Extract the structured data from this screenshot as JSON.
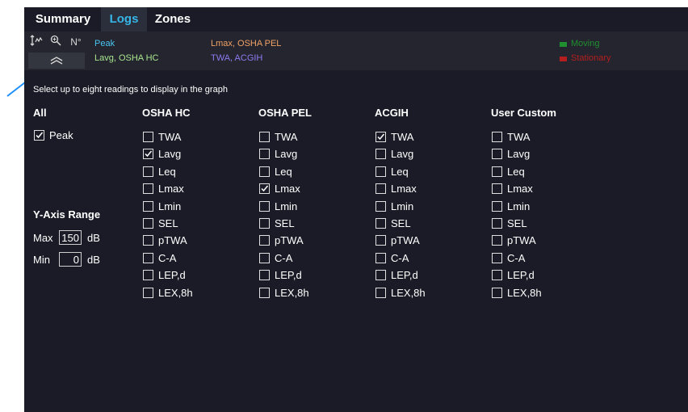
{
  "tabs": [
    {
      "label": "Summary"
    },
    {
      "label": "Logs"
    },
    {
      "label": "Zones"
    }
  ],
  "toolbar": {
    "icons": [
      "vertical-arrows-icon",
      "zoom-icon",
      "north-icon"
    ],
    "north_label": "N°",
    "collapse_icon": "double-chevron-up-icon"
  },
  "legend": {
    "items": [
      {
        "label": "Peak",
        "color": "#48c6f0"
      },
      {
        "label": "Lavg, OSHA HC",
        "color": "#a8e68f"
      },
      {
        "label": "Lmax, OSHA PEL",
        "color": "#f0a264"
      },
      {
        "label": "TWA, ACGIH",
        "color": "#8a7cf0"
      },
      {
        "label": "Moving",
        "color": "#1f8f2f"
      },
      {
        "label": "Stationary",
        "color": "#b51e1e"
      }
    ]
  },
  "instruction": "Select up to eight readings to display in the graph",
  "all_section": {
    "title": "All",
    "peak": {
      "label": "Peak",
      "checked": true
    }
  },
  "columns": [
    {
      "title": "OSHA HC",
      "items": [
        {
          "label": "TWA",
          "checked": false
        },
        {
          "label": "Lavg",
          "checked": true
        },
        {
          "label": "Leq",
          "checked": false
        },
        {
          "label": "Lmax",
          "checked": false
        },
        {
          "label": "Lmin",
          "checked": false
        },
        {
          "label": "SEL",
          "checked": false
        },
        {
          "label": "pTWA",
          "checked": false
        },
        {
          "label": "C-A",
          "checked": false
        },
        {
          "label": "LEP,d",
          "checked": false
        },
        {
          "label": "LEX,8h",
          "checked": false
        }
      ]
    },
    {
      "title": "OSHA PEL",
      "items": [
        {
          "label": "TWA",
          "checked": false
        },
        {
          "label": "Lavg",
          "checked": false
        },
        {
          "label": "Leq",
          "checked": false
        },
        {
          "label": "Lmax",
          "checked": true
        },
        {
          "label": "Lmin",
          "checked": false
        },
        {
          "label": "SEL",
          "checked": false
        },
        {
          "label": "pTWA",
          "checked": false
        },
        {
          "label": "C-A",
          "checked": false
        },
        {
          "label": "LEP,d",
          "checked": false
        },
        {
          "label": "LEX,8h",
          "checked": false
        }
      ]
    },
    {
      "title": "ACGIH",
      "items": [
        {
          "label": "TWA",
          "checked": true
        },
        {
          "label": "Lavg",
          "checked": false
        },
        {
          "label": "Leq",
          "checked": false
        },
        {
          "label": "Lmax",
          "checked": false
        },
        {
          "label": "Lmin",
          "checked": false
        },
        {
          "label": "SEL",
          "checked": false
        },
        {
          "label": "pTWA",
          "checked": false
        },
        {
          "label": "C-A",
          "checked": false
        },
        {
          "label": "LEP,d",
          "checked": false
        },
        {
          "label": "LEX,8h",
          "checked": false
        }
      ]
    },
    {
      "title": "User Custom",
      "items": [
        {
          "label": "TWA",
          "checked": false
        },
        {
          "label": "Lavg",
          "checked": false
        },
        {
          "label": "Leq",
          "checked": false
        },
        {
          "label": "Lmax",
          "checked": false
        },
        {
          "label": "Lmin",
          "checked": false
        },
        {
          "label": "SEL",
          "checked": false
        },
        {
          "label": "pTWA",
          "checked": false
        },
        {
          "label": "C-A",
          "checked": false
        },
        {
          "label": "LEP,d",
          "checked": false
        },
        {
          "label": "LEX,8h",
          "checked": false
        }
      ]
    }
  ],
  "y_axis": {
    "title": "Y-Axis Range",
    "max_label": "Max",
    "max_value": "150",
    "max_unit": "dB",
    "min_label": "Min",
    "min_value": "0",
    "min_unit": "dB"
  },
  "annotation": {
    "icon": "arrow-pointer-icon",
    "color": "#1e90ff"
  }
}
